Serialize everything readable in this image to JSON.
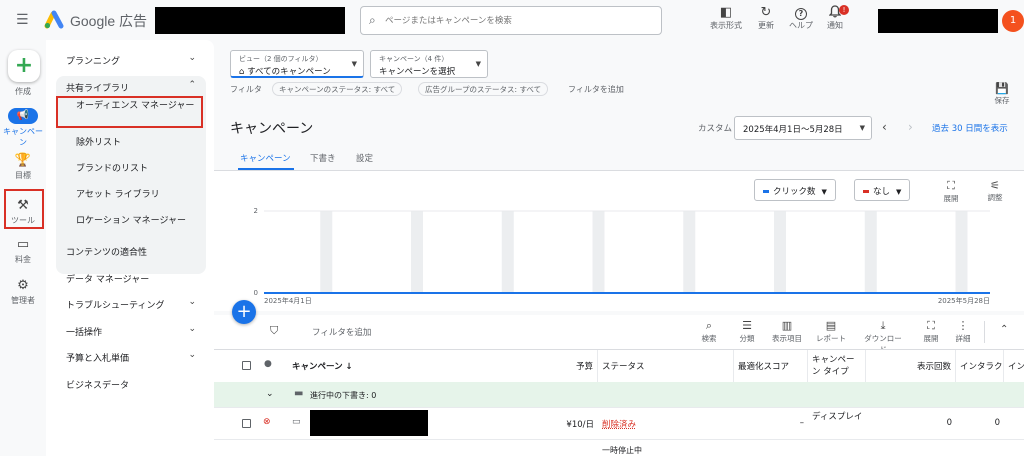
{
  "header": {
    "brand": "Google 広告",
    "search_placeholder": "ページまたはキャンペーンを検索",
    "tools": [
      {
        "icon": "display-mode-icon",
        "glyph": "◧",
        "label": "表示形式"
      },
      {
        "icon": "refresh-icon",
        "glyph": "↻",
        "label": "更新"
      },
      {
        "icon": "help-icon",
        "glyph": "?",
        "label": "ヘルプ"
      },
      {
        "icon": "bell-icon",
        "glyph": "🔔",
        "label": "通知",
        "badge": "!"
      }
    ],
    "avatar": "1"
  },
  "rail": {
    "items": [
      {
        "icon": "plus-icon",
        "label": "作成"
      },
      {
        "icon": "megaphone-icon",
        "label": "キャンペーン",
        "active": true
      },
      {
        "icon": "trophy-icon",
        "label": "目標"
      },
      {
        "icon": "tools-icon",
        "label": "ツール"
      },
      {
        "icon": "billing-icon",
        "label": "料金"
      },
      {
        "icon": "gear-icon",
        "label": "管理者"
      }
    ]
  },
  "nav": {
    "planning": "プランニング",
    "shared_library": "共有ライブラリ",
    "shared_items": [
      "オーディエンス マネージャー",
      "除外リスト",
      "ブランドのリスト",
      "アセット ライブラリ",
      "ロケーション マネージャー"
    ],
    "content_suitability": "コンテンツの適合性",
    "data_manager": "データ マネージャー",
    "troubleshooting": "トラブルシューティング",
    "bulk_actions": "一括操作",
    "budgets_bidding": "予算と入札単価",
    "business_data": "ビジネスデータ"
  },
  "main": {
    "view_selector": {
      "small": "ビュー（2 個のフィルタ）",
      "big": "すべてのキャンペーン"
    },
    "campaign_selector": {
      "small": "キャンペーン（4 件）",
      "big": "キャンペーンを選択"
    },
    "filter_label": "フィルタ",
    "filter_chips": [
      "キャンペーンのステータス: すべて",
      "広告グループのステータス: すべて"
    ],
    "add_filter": "フィルタを追加",
    "save": "保存",
    "title": "キャンペーン",
    "date_label": "カスタム",
    "date_range": "2025年4月1日～5月28日",
    "compare_link": "過去 30 日間を表示",
    "tabs": [
      "キャンペーン",
      "下書き",
      "設定"
    ]
  },
  "chart_data": {
    "type": "line",
    "metric_selectors": [
      {
        "label": "クリック数",
        "color": "#1a73e8"
      },
      {
        "label": "なし",
        "color": "#d93025"
      }
    ],
    "tools": [
      {
        "icon": "expand-icon",
        "label": "展開"
      },
      {
        "icon": "adjust-icon",
        "label": "調整"
      }
    ],
    "y_ticks": [
      "2",
      "1",
      "0"
    ],
    "ylim": [
      0,
      2
    ],
    "x_start_label": "2025年4月1日",
    "x_end_label": "2025年5月28日",
    "series": [
      {
        "values": [
          0,
          0
        ]
      }
    ],
    "weekend_bands": 8
  },
  "table": {
    "add_filter": "フィルタを追加",
    "tools": [
      {
        "icon": "search-icon",
        "glyph": "⌕",
        "label": "検索"
      },
      {
        "icon": "segment-icon",
        "glyph": "☰",
        "label": "分類"
      },
      {
        "icon": "columns-icon",
        "glyph": "▥",
        "label": "表示項目"
      },
      {
        "icon": "report-icon",
        "glyph": "▤",
        "label": "レポート"
      },
      {
        "icon": "download-icon",
        "glyph": "⤓",
        "label": "ダウンロード"
      },
      {
        "icon": "expand-icon",
        "glyph": "⛶",
        "label": "展開"
      },
      {
        "icon": "more-icon",
        "glyph": "⋮",
        "label": "詳細"
      }
    ],
    "headers": [
      "キャンペーン ↓",
      "予算",
      "ステータス",
      "最適化スコア",
      "キャンペーン タイプ",
      "表示回数",
      "インタラクション",
      "イン"
    ],
    "draft_row": "進行中の下書き: 0",
    "rows": [
      {
        "budget": "¥10/日",
        "status": "削除済み",
        "score": "–",
        "type": "ディスプレイ",
        "impressions": "0",
        "interactions": "0"
      }
    ],
    "next_row_status": "一時停止中"
  }
}
